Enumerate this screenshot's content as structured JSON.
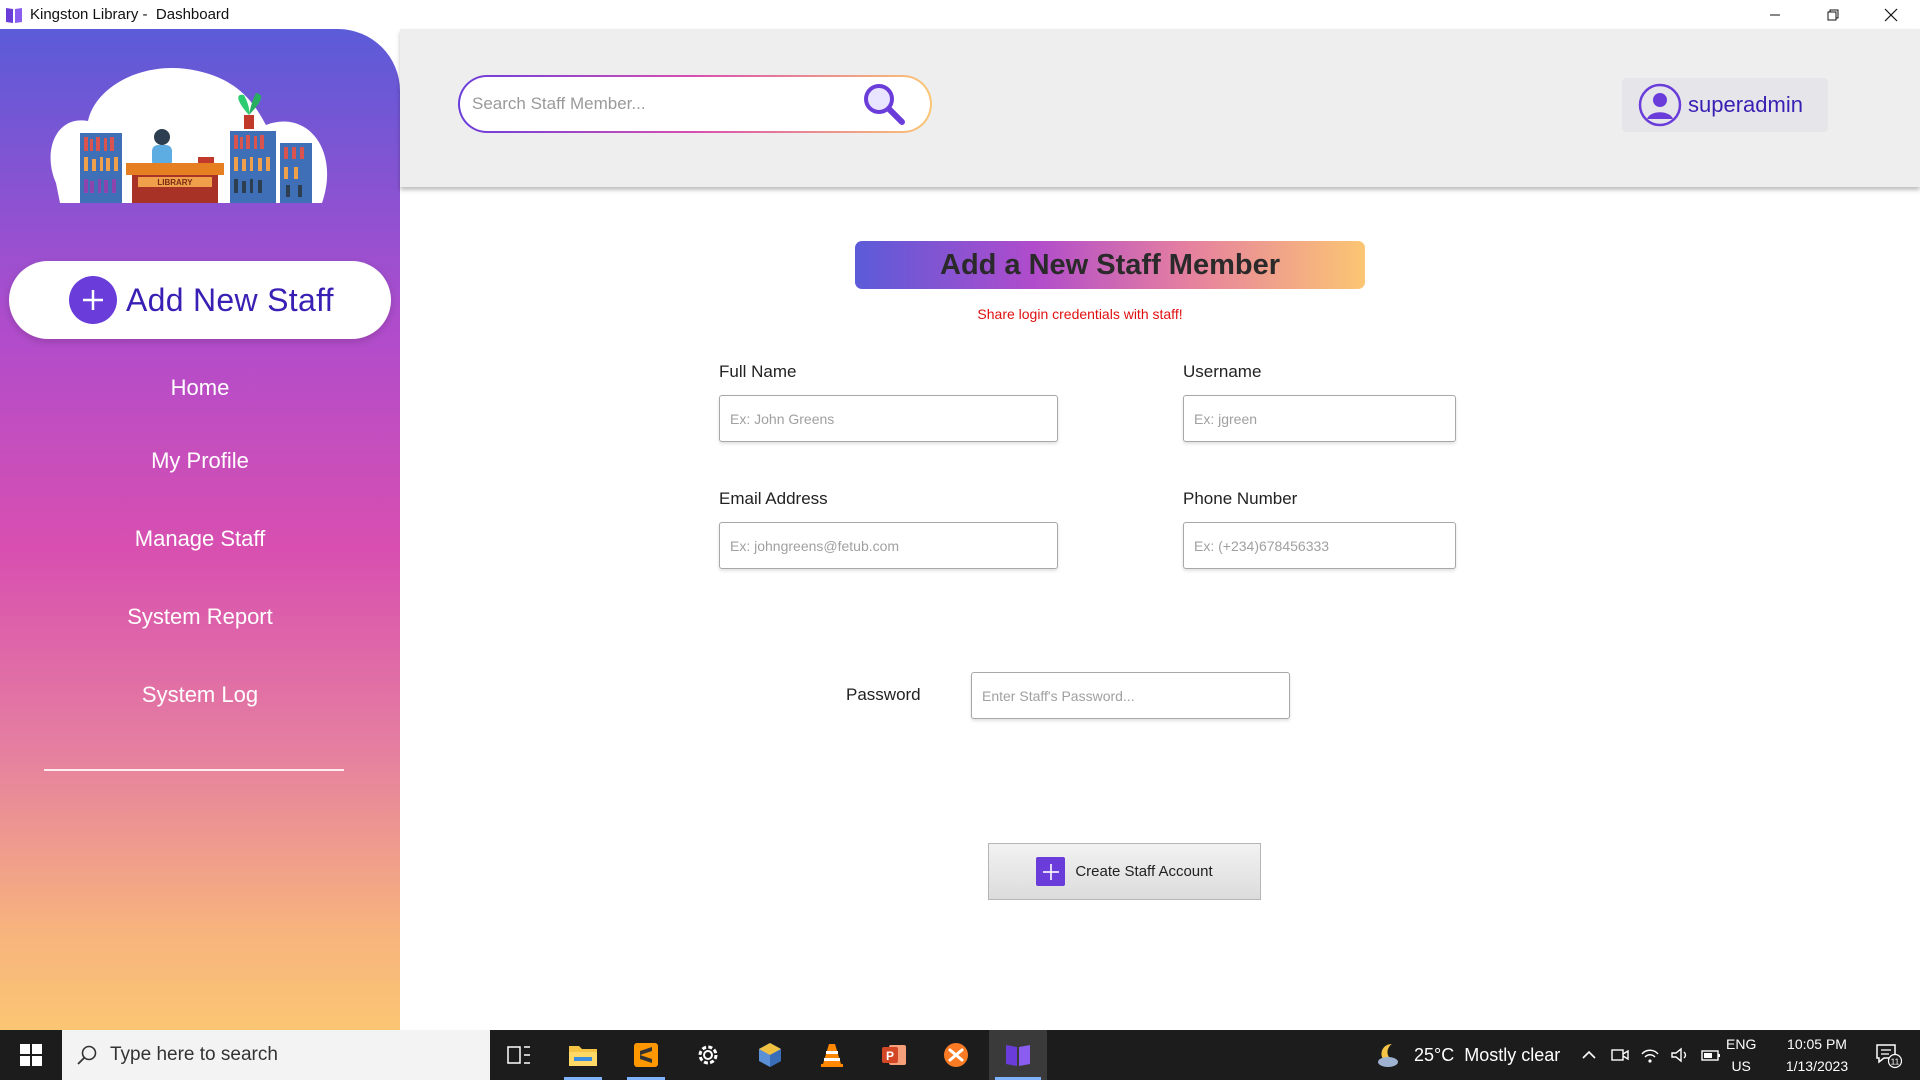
{
  "window": {
    "title": "Kingston Library -  Dashboard"
  },
  "sidebar": {
    "logo_text": "LIBRARY",
    "add_button_label": "Add New Staff",
    "items": [
      {
        "label": "Home"
      },
      {
        "label": "My Profile"
      },
      {
        "label": "Manage Staff"
      },
      {
        "label": "System Report"
      },
      {
        "label": "System Log"
      }
    ]
  },
  "header": {
    "search_placeholder": "Search Staff Member...",
    "username": "superadmin"
  },
  "form": {
    "title": "Add a New Staff Member",
    "hint": "Share login credentials with staff!",
    "full_name": {
      "label": "Full Name",
      "placeholder": "Ex: John Greens",
      "value": ""
    },
    "username": {
      "label": "Username",
      "placeholder": "Ex: jgreen",
      "value": ""
    },
    "email": {
      "label": "Email Address",
      "placeholder": "Ex: johngreens@fetub.com",
      "value": ""
    },
    "phone": {
      "label": "Phone Number",
      "placeholder": "Ex: (+234)678456333",
      "value": ""
    },
    "password": {
      "label": "Password",
      "placeholder": "Enter Staff's Password...",
      "value": ""
    },
    "submit_label": "Create Staff Account"
  },
  "taskbar": {
    "search_text": "Type here to search",
    "weather_temp": "25°C",
    "weather_desc": "Mostly clear",
    "lang_top": "ENG",
    "lang_bottom": "US",
    "time": "10:05 PM",
    "date": "1/13/2023",
    "notification_count": "11"
  },
  "colors": {
    "accent": "#6a3ddb",
    "accent_text": "#3a1fb4",
    "hint_red": "#e01010",
    "header_bg": "#eeeeee",
    "taskbar_bg": "#1c1c1c"
  }
}
